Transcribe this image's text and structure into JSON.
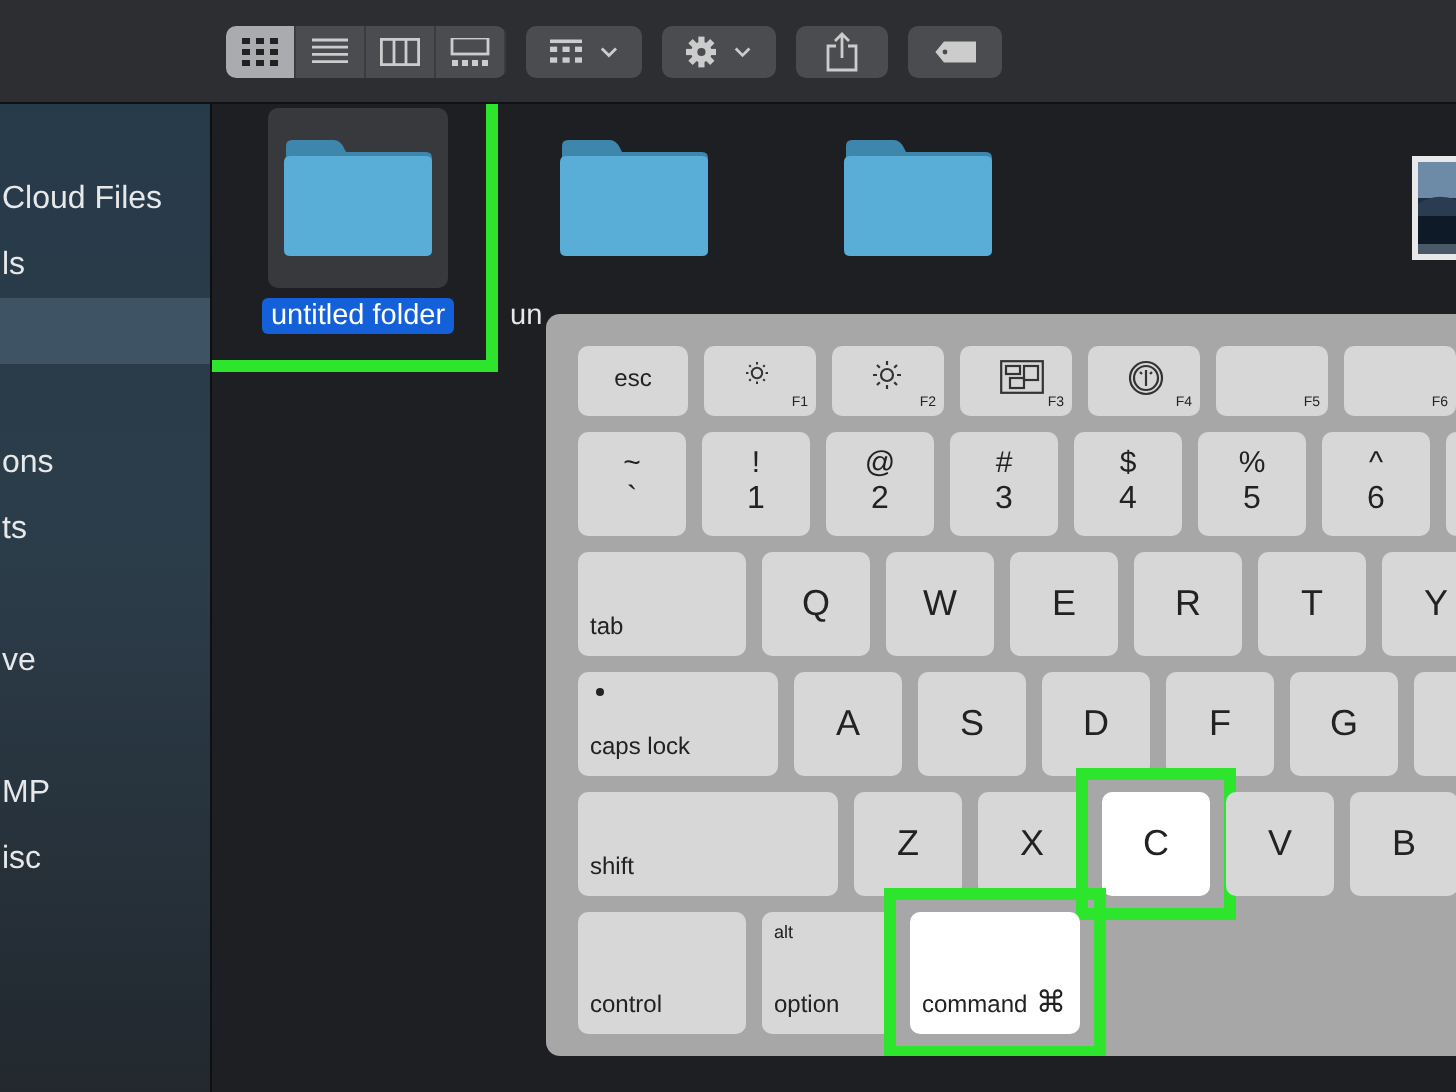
{
  "toolbar": {
    "view_buttons": [
      {
        "kind": "icons",
        "selected": true
      },
      {
        "kind": "list",
        "selected": false
      },
      {
        "kind": "columns",
        "selected": false
      },
      {
        "kind": "gallery",
        "selected": false
      }
    ],
    "buttons": [
      {
        "kind": "group"
      },
      {
        "kind": "action"
      },
      {
        "kind": "share"
      },
      {
        "kind": "tag"
      }
    ]
  },
  "sidebar": {
    "sections": [
      {
        "items": [
          {
            "label": "Cloud Files",
            "selected": false
          },
          {
            "label": "ls",
            "selected": false
          },
          {
            "selected": true
          }
        ]
      },
      {
        "items": [
          {
            "label": "ons",
            "selected": false
          },
          {
            "label": "ts",
            "selected": false
          }
        ]
      },
      {
        "items": [
          {
            "label": "ve",
            "selected": false
          }
        ]
      },
      {
        "items": [
          {
            "label": "MP",
            "selected": false
          },
          {
            "label": "isc",
            "selected": false
          }
        ]
      }
    ]
  },
  "folders": [
    {
      "kind": "folder",
      "label": "untitled folder",
      "selected": true,
      "annotated": true
    },
    {
      "kind": "folder",
      "label": "un",
      "selected": false,
      "annotated": false
    },
    {
      "kind": "folder",
      "selected": false,
      "annotated": false
    },
    {
      "kind": "picture"
    }
  ],
  "keyboard": {
    "rows": [
      {
        "keys": [
          {
            "kind": "mod",
            "label": "esc",
            "highlighted": false
          },
          {
            "kind": "fn",
            "label": "F1",
            "highlighted": false
          },
          {
            "kind": "fn",
            "label": "F2",
            "highlighted": false
          },
          {
            "kind": "fn",
            "label": "F3",
            "highlighted": false
          },
          {
            "kind": "fn",
            "label": "F4",
            "highlighted": false
          },
          {
            "kind": "fn",
            "label": "F5",
            "highlighted": false
          },
          {
            "kind": "fn",
            "label": "F6",
            "highlighted": false
          }
        ]
      },
      {
        "keys": [
          {
            "kind": "pair",
            "top": "~",
            "label": "`",
            "highlighted": false
          },
          {
            "kind": "pair",
            "top": "!",
            "label": "1",
            "highlighted": false
          },
          {
            "kind": "pair",
            "top": "@",
            "label": "2",
            "highlighted": false
          },
          {
            "kind": "pair",
            "top": "#",
            "label": "3",
            "highlighted": false
          },
          {
            "kind": "pair",
            "top": "$",
            "label": "4",
            "highlighted": false
          },
          {
            "kind": "pair",
            "top": "%",
            "label": "5",
            "highlighted": false
          },
          {
            "kind": "pair",
            "top": "^",
            "label": "6",
            "highlighted": false
          },
          {
            "kind": "blank",
            "highlighted": false
          }
        ]
      },
      {
        "keys": [
          {
            "kind": "mod",
            "label": "tab",
            "highlighted": false
          },
          {
            "kind": "letter",
            "label": "Q",
            "highlighted": false
          },
          {
            "kind": "letter",
            "label": "W",
            "highlighted": false
          },
          {
            "kind": "letter",
            "label": "E",
            "highlighted": false
          },
          {
            "kind": "letter",
            "label": "R",
            "highlighted": false
          },
          {
            "kind": "letter",
            "label": "T",
            "highlighted": false
          },
          {
            "kind": "letter",
            "label": "Y",
            "highlighted": false
          }
        ]
      },
      {
        "keys": [
          {
            "kind": "mod",
            "label": "caps lock",
            "led": true,
            "highlighted": false
          },
          {
            "kind": "letter",
            "label": "A",
            "highlighted": false
          },
          {
            "kind": "letter",
            "label": "S",
            "highlighted": false
          },
          {
            "kind": "letter",
            "label": "D",
            "highlighted": false
          },
          {
            "kind": "letter",
            "label": "F",
            "highlighted": false
          },
          {
            "kind": "letter",
            "label": "G",
            "highlighted": false
          },
          {
            "kind": "blank",
            "highlighted": false
          }
        ]
      },
      {
        "keys": [
          {
            "kind": "mod",
            "label": "shift",
            "highlighted": false
          },
          {
            "kind": "letter",
            "label": "Z",
            "highlighted": false
          },
          {
            "kind": "letter",
            "label": "X",
            "highlighted": false
          },
          {
            "kind": "letter",
            "label": "C",
            "highlighted": true
          },
          {
            "kind": "letter",
            "label": "V",
            "highlighted": false
          },
          {
            "kind": "letter",
            "label": "B",
            "highlighted": false
          }
        ]
      },
      {
        "keys": [
          {
            "kind": "mod",
            "label": "control",
            "highlighted": false
          },
          {
            "kind": "mod",
            "top": "alt",
            "label": "option",
            "highlighted": false
          },
          {
            "kind": "mod",
            "label": "command",
            "symbol": "⌘",
            "highlighted": true
          }
        ]
      }
    ]
  }
}
